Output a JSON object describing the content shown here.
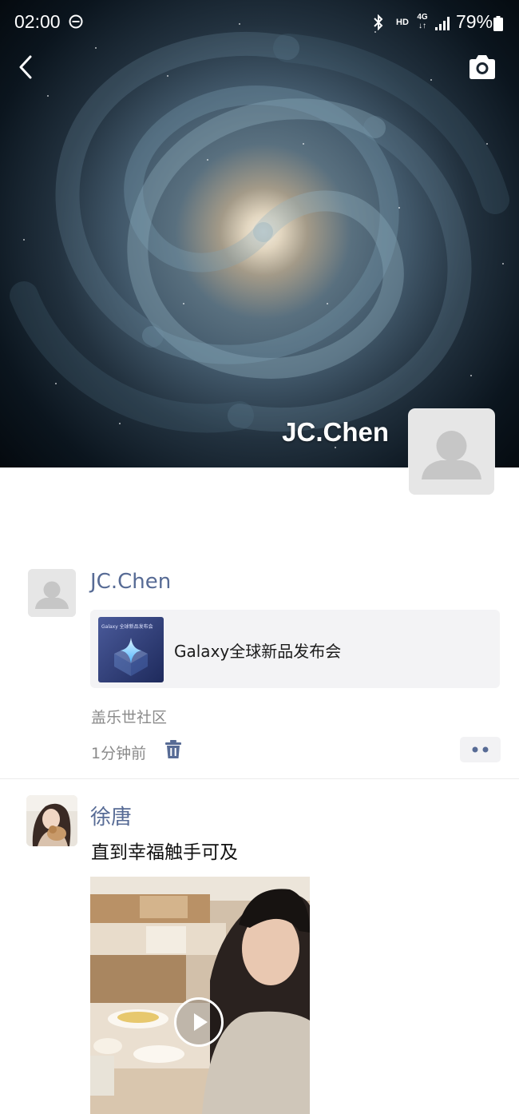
{
  "status_bar": {
    "time": "02:00",
    "hd": "HD",
    "network": "4G",
    "battery": "79%"
  },
  "cover": {
    "name": "JC.Chen"
  },
  "posts": [
    {
      "author": "JC.Chen",
      "share_card": {
        "title": "Galaxy全球新品发布会",
        "thumb_caption": "Galaxy 全球新品发布会"
      },
      "location": "盖乐世社区",
      "time_ago": "1分钟前"
    },
    {
      "author": "徐唐",
      "text": "直到幸福触手可及"
    }
  ],
  "icons": [
    "back-arrow-icon",
    "camera-icon",
    "avatar-placeholder-icon",
    "trash-icon",
    "more-dots-icon",
    "play-icon"
  ],
  "colors": {
    "link_name": "#576b95",
    "meta_gray": "#8a8a8a",
    "card_bg": "#f3f3f5"
  }
}
